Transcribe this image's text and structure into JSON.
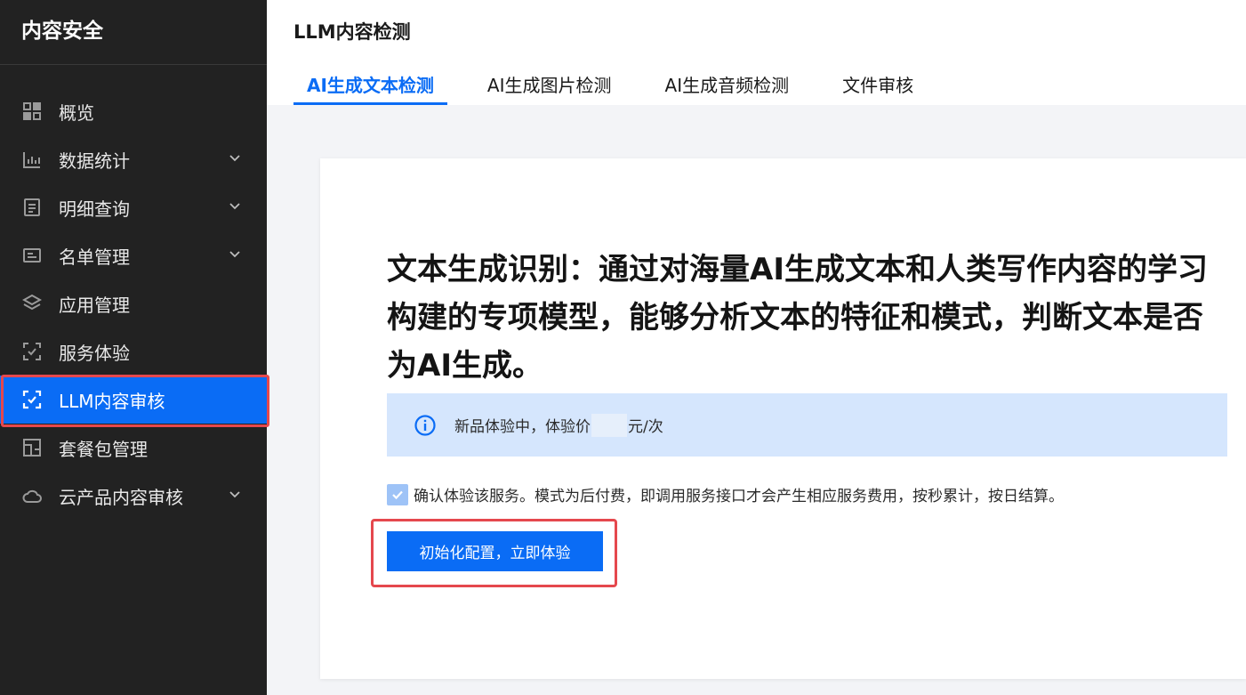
{
  "sidebar": {
    "brand": "内容安全",
    "items": [
      {
        "label": "概览",
        "icon": "grid-icon",
        "expandable": false,
        "active": false
      },
      {
        "label": "数据统计",
        "icon": "bar-chart-icon",
        "expandable": true,
        "active": false
      },
      {
        "label": "明细查询",
        "icon": "list-doc-icon",
        "expandable": true,
        "active": false
      },
      {
        "label": "名单管理",
        "icon": "id-card-icon",
        "expandable": true,
        "active": false
      },
      {
        "label": "应用管理",
        "icon": "layers-icon",
        "expandable": false,
        "active": false
      },
      {
        "label": "服务体验",
        "icon": "scan-icon",
        "expandable": false,
        "active": false
      },
      {
        "label": "LLM内容审核",
        "icon": "scan-check-icon",
        "expandable": false,
        "active": true
      },
      {
        "label": "套餐包管理",
        "icon": "package-icon",
        "expandable": false,
        "active": false
      },
      {
        "label": "云产品内容审核",
        "icon": "cloud-icon",
        "expandable": true,
        "active": false
      }
    ]
  },
  "header": {
    "title": "LLM内容检测",
    "tabs": [
      {
        "label": "AI生成文本检测",
        "active": true
      },
      {
        "label": "AI生成图片检测",
        "active": false
      },
      {
        "label": "AI生成音频检测",
        "active": false
      },
      {
        "label": "文件审核",
        "active": false
      }
    ]
  },
  "card": {
    "headline": "文本生成识别：通过对海量AI生成文本和人类写作内容的学习构建的专项模型，能够分析文本的特征和模式，判断文本是否为AI生成。",
    "notice": {
      "prefix": "新品体验中，体验价",
      "suffix": "元/次"
    },
    "confirm_text": "确认体验该服务。模式为后付费，即调用服务接口才会产生相应服务费用，按秒累计，按日结算。",
    "confirm_checked": true,
    "cta_label": "初始化配置，立即体验"
  },
  "colors": {
    "primary": "#0a6cf5",
    "sidebar_bg": "#222222",
    "highlight": "#e5484d",
    "notice_bg": "#d5e6fd"
  }
}
